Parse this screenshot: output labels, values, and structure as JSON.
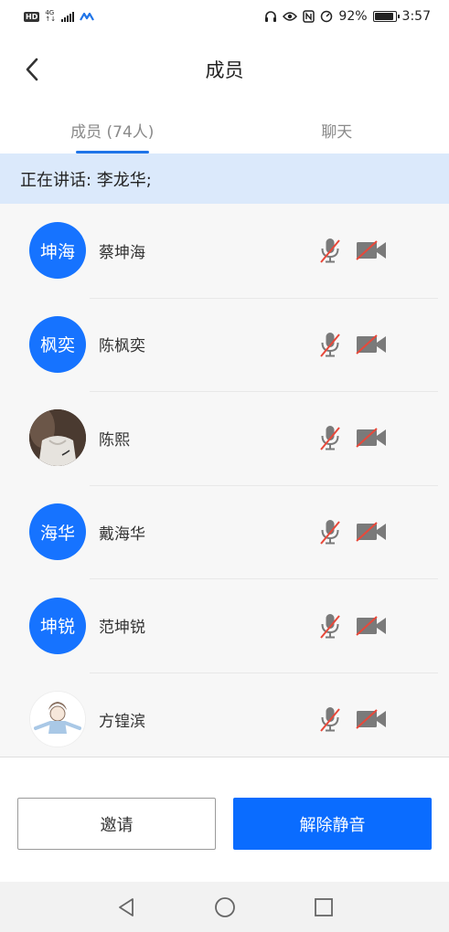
{
  "status_bar": {
    "hd": "HD",
    "network": "4G",
    "battery": "92%",
    "battery_level": 0.92,
    "time": "3:57"
  },
  "nav": {
    "title": "成员"
  },
  "tabs": [
    {
      "label": "成员 (74人)",
      "active": true
    },
    {
      "label": "聊天",
      "active": false
    }
  ],
  "speaking": {
    "text": "正在讲话: 李龙华;"
  },
  "members": [
    {
      "name": "蔡坤海",
      "avatar_text": "坤海",
      "avatar_type": "text",
      "mic": "muted",
      "camera": "off"
    },
    {
      "name": "陈枫奕",
      "avatar_text": "枫奕",
      "avatar_type": "text",
      "mic": "muted",
      "camera": "off"
    },
    {
      "name": "陈熙",
      "avatar_text": "",
      "avatar_type": "photo",
      "mic": "muted",
      "camera": "off"
    },
    {
      "name": "戴海华",
      "avatar_text": "海华",
      "avatar_type": "text",
      "mic": "muted",
      "camera": "off"
    },
    {
      "name": "范坤锐",
      "avatar_text": "坤锐",
      "avatar_type": "text",
      "mic": "muted",
      "camera": "off"
    },
    {
      "name": "方锽滨",
      "avatar_text": "",
      "avatar_type": "cartoon",
      "mic": "muted",
      "camera": "off"
    }
  ],
  "buttons": {
    "invite": "邀请",
    "unmute": "解除静音"
  },
  "colors": {
    "accent": "#1673ff",
    "banner": "#dbe9fb",
    "muted_slash": "#e8483a",
    "icon_gray": "#7a7a7a"
  },
  "icons": [
    "back-icon",
    "mic-muted-icon",
    "camera-off-icon",
    "back-triangle-icon",
    "home-circle-icon",
    "recents-square-icon"
  ]
}
